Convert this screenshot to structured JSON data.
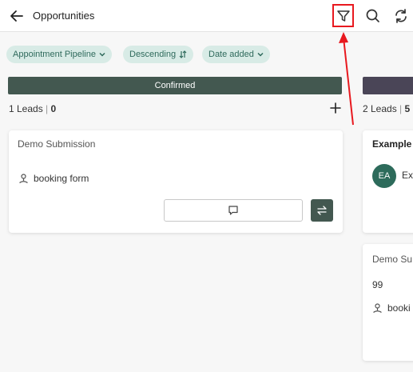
{
  "header": {
    "title": "Opportunities"
  },
  "filters": {
    "pipeline": "Appointment Pipeline",
    "sort_order": "Descending",
    "sort_by": "Date added"
  },
  "columns": [
    {
      "name": "Confirmed",
      "leads_label": "1 Leads",
      "separator": "|",
      "amount": "0",
      "cards": [
        {
          "title": "Demo Submission",
          "source": "booking form"
        }
      ]
    },
    {
      "name": "",
      "leads_label": "2 Leads",
      "separator": "|",
      "amount": "5",
      "cards": [
        {
          "title": "Example",
          "avatar": "EA",
          "contact": "Ex"
        },
        {
          "title": "Demo Su",
          "value": "99",
          "source": "booki"
        }
      ]
    }
  ],
  "colors": {
    "accent": "#435850",
    "chip_bg": "#d8ebe6",
    "chip_text": "#2f6a5c",
    "annotation": "#e8191f"
  },
  "icons": {
    "back": "arrow-left-icon",
    "filter": "filter-icon",
    "search": "search-icon",
    "refresh": "refresh-icon",
    "add": "plus-icon",
    "source": "location-pin-icon",
    "note": "chat-bubble-icon",
    "move": "swap-arrows-icon"
  }
}
